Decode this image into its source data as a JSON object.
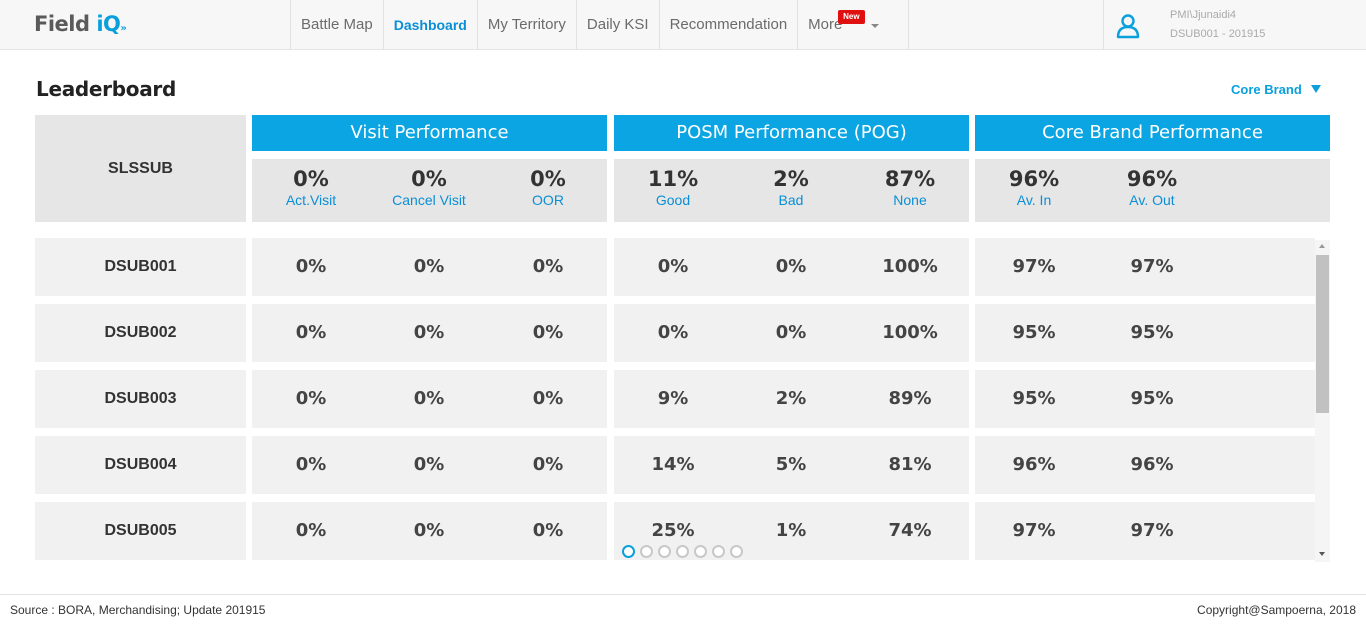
{
  "app": {
    "logo_text_a": "Field",
    "logo_text_b": "iQ",
    "logo_chevron": "»"
  },
  "nav": {
    "items": [
      {
        "label": "Battle Map",
        "active": false
      },
      {
        "label": "Dashboard",
        "active": true
      },
      {
        "label": "My Territory",
        "active": false
      },
      {
        "label": "Daily KSI",
        "active": false
      },
      {
        "label": "Recommendation",
        "active": false
      },
      {
        "label": "More",
        "active": false
      }
    ],
    "new_badge": "New"
  },
  "user": {
    "name": "PMI\\Jjunaidi4",
    "subtitle": "DSUB001 - 201915",
    "icon": "user-icon"
  },
  "page": {
    "title": "Leaderboard",
    "brand_filter": "Core Brand"
  },
  "header": {
    "label": "SLSSUB",
    "groups": [
      {
        "title": "Visit Performance",
        "metrics": [
          {
            "value": "0%",
            "label": "Act.Visit"
          },
          {
            "value": "0%",
            "label": "Cancel Visit"
          },
          {
            "value": "0%",
            "label": "OOR"
          }
        ]
      },
      {
        "title": "POSM Performance (POG)",
        "metrics": [
          {
            "value": "11%",
            "label": "Good"
          },
          {
            "value": "2%",
            "label": "Bad"
          },
          {
            "value": "87%",
            "label": "None"
          }
        ]
      },
      {
        "title": "Core Brand Performance",
        "metrics": [
          {
            "value": "96%",
            "label": "Av. In"
          },
          {
            "value": "96%",
            "label": "Av. Out"
          }
        ]
      }
    ]
  },
  "rows": [
    {
      "name": "DSUB001",
      "visit": [
        "0%",
        "0%",
        "0%"
      ],
      "posm": [
        "0%",
        "0%",
        "100%"
      ],
      "brand": [
        "97%",
        "97%"
      ]
    },
    {
      "name": "DSUB002",
      "visit": [
        "0%",
        "0%",
        "0%"
      ],
      "posm": [
        "0%",
        "0%",
        "100%"
      ],
      "brand": [
        "95%",
        "95%"
      ]
    },
    {
      "name": "DSUB003",
      "visit": [
        "0%",
        "0%",
        "0%"
      ],
      "posm": [
        "9%",
        "2%",
        "89%"
      ],
      "brand": [
        "95%",
        "95%"
      ]
    },
    {
      "name": "DSUB004",
      "visit": [
        "0%",
        "0%",
        "0%"
      ],
      "posm": [
        "14%",
        "5%",
        "81%"
      ],
      "brand": [
        "96%",
        "96%"
      ]
    },
    {
      "name": "DSUB005",
      "visit": [
        "0%",
        "0%",
        "0%"
      ],
      "posm": [
        "25%",
        "1%",
        "74%"
      ],
      "brand": [
        "97%",
        "97%"
      ]
    }
  ],
  "pagination": {
    "pages": 7,
    "current": 1
  },
  "footer": {
    "source": "Source : BORA, Merchandising; Update 201915",
    "copyright": "Copyright@Sampoerna, 2018"
  },
  "colors": {
    "accent": "#0aa5e2",
    "link": "#0a8fd6",
    "badge": "#e01010"
  }
}
